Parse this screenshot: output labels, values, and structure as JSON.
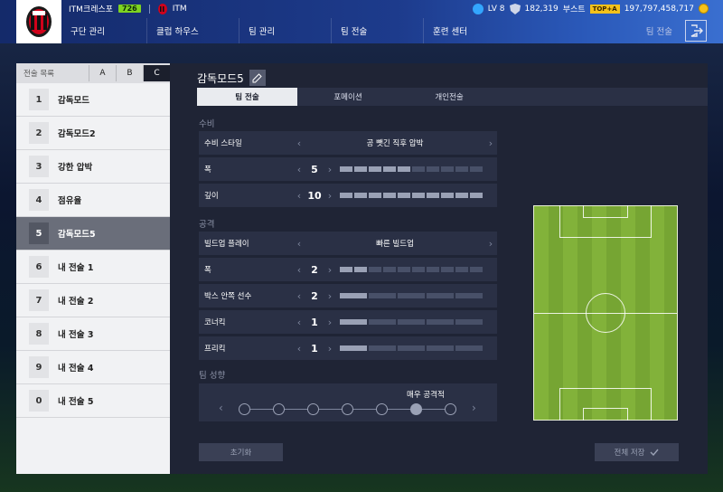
{
  "header": {
    "club_name": "ITM크레스포",
    "ovr": "726",
    "team_name": "ITM",
    "level": "LV 8",
    "fc_points": "182,319",
    "boost_label": "부스트",
    "boost_badge": "TOP+A",
    "coins": "197,797,458,717",
    "nav": [
      "구단 관리",
      "클럽 하우스",
      "팀 관리",
      "팀 전술",
      "훈련 센터"
    ],
    "current_page": "팀 전술",
    "accent_color": "#1d3b8c"
  },
  "tactic_list": {
    "title": "전술 목록",
    "tabs": [
      "A",
      "B",
      "C"
    ],
    "active_tab": "C",
    "items": [
      {
        "num": "1",
        "name": "감독모드"
      },
      {
        "num": "2",
        "name": "감독모드2"
      },
      {
        "num": "3",
        "name": "강한 압박"
      },
      {
        "num": "4",
        "name": "점유율"
      },
      {
        "num": "5",
        "name": "감독모드5"
      },
      {
        "num": "6",
        "name": "내 전술 1"
      },
      {
        "num": "7",
        "name": "내 전술 2"
      },
      {
        "num": "8",
        "name": "내 전술 3"
      },
      {
        "num": "9",
        "name": "내 전술 4"
      },
      {
        "num": "0",
        "name": "내 전술 5"
      }
    ],
    "selected": "5"
  },
  "main": {
    "title": "감독모드5",
    "sub_tabs": [
      "팀 전술",
      "포메이션",
      "개인전술"
    ],
    "active_sub_tab": "팀 전술",
    "defense": {
      "label": "수비",
      "style_label": "수비 스타일",
      "style_value": "공 뺏긴 직후 압박",
      "width_label": "폭",
      "width_value": "5",
      "depth_label": "깊이",
      "depth_value": "10"
    },
    "attack": {
      "label": "공격",
      "buildup_label": "빌드업 플레이",
      "buildup_value": "빠른 빌드업",
      "width_label": "폭",
      "width_value": "2",
      "box_label": "박스 안쪽 선수",
      "box_value": "2",
      "corner_label": "코너킥",
      "corner_value": "1",
      "freekick_label": "프리킥",
      "freekick_value": "1"
    },
    "tendency": {
      "label": "팀 성향",
      "value": "매우 공격적",
      "steps": 7,
      "selected_step": 6
    },
    "reset_label": "초기화",
    "save_label": "전체 저장"
  }
}
